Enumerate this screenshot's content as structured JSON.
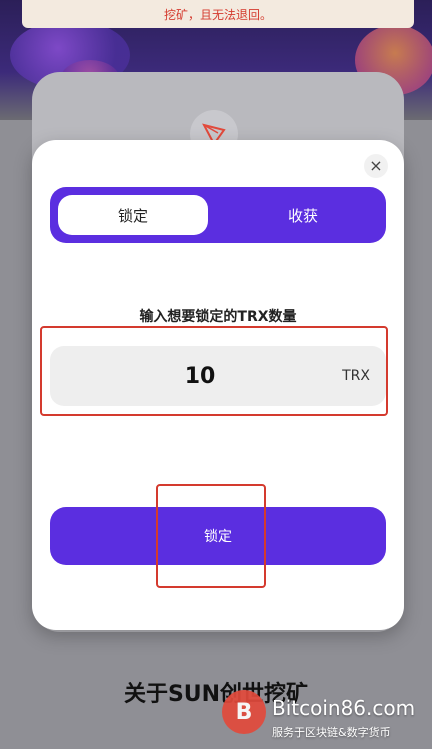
{
  "notice": {
    "text": "挖矿，且无法退回。"
  },
  "modal": {
    "close_icon": "×",
    "tabs": [
      {
        "label": "锁定",
        "active": true
      },
      {
        "label": "收获",
        "active": false
      }
    ],
    "input_label": "输入想要锁定的TRX数量",
    "amount_value": "10",
    "unit": "TRX",
    "submit_label": "锁定"
  },
  "section": {
    "title": "关于SUN创世挖矿"
  },
  "watermark": {
    "logo_glyph": "B",
    "title": "Bitcoin86.com",
    "subtitle": "服务于区块链&数字货币"
  },
  "colors": {
    "accent": "#5b2ee0",
    "annotation": "#d43a2e",
    "notice_text": "#d43a2e"
  },
  "icons": {
    "tron": "tron-logo-icon",
    "close": "close-icon",
    "watermark_logo": "bitcoin-icon"
  }
}
